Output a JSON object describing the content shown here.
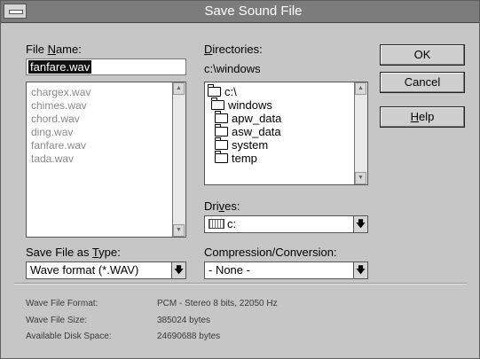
{
  "window": {
    "title": "Save Sound File"
  },
  "file_name": {
    "label_prefix": "File ",
    "label_ul": "N",
    "label_suffix": "ame:",
    "value": "fanfare.wav"
  },
  "file_list": [
    "chargex.wav",
    "chimes.wav",
    "chord.wav",
    "ding.wav",
    "fanfare.wav",
    "tada.wav"
  ],
  "directories": {
    "label_ul": "D",
    "label_suffix": "irectories:",
    "current_path": "c:\\windows",
    "items": [
      {
        "name": "c:\\",
        "icon": "open-folder-icon",
        "indent": 0
      },
      {
        "name": "windows",
        "icon": "open-folder-icon",
        "indent": 1
      },
      {
        "name": "apw_data",
        "icon": "folder-icon",
        "indent": 2
      },
      {
        "name": "asw_data",
        "icon": "folder-icon",
        "indent": 2
      },
      {
        "name": "system",
        "icon": "folder-icon",
        "indent": 2
      },
      {
        "name": "temp",
        "icon": "folder-icon",
        "indent": 2
      }
    ]
  },
  "drives": {
    "label_prefix": "Dri",
    "label_ul": "v",
    "label_suffix": "es:",
    "value": "c:",
    "icon": "hard-drive-icon"
  },
  "file_type": {
    "label_prefix": "Save File as ",
    "label_ul": "T",
    "label_suffix": "ype:",
    "value": "Wave format (*.WAV)"
  },
  "compression": {
    "label": "Compression/Conversion:",
    "value": "- None -"
  },
  "buttons": {
    "ok": "OK",
    "cancel": "Cancel",
    "help_ul": "H",
    "help_suffix": "elp"
  },
  "info": {
    "format_label": "Wave File Format:",
    "format_value": "PCM - Stereo 8 bits, 22050 Hz",
    "size_label": "Wave File Size:",
    "size_value": "385024 bytes",
    "disk_label": "Available Disk Space:",
    "disk_value": "24690688 bytes"
  },
  "colors": {
    "dialog_bg": "#c6c6c6",
    "titlebar": "#7c7c7c",
    "selection": "#111111"
  }
}
